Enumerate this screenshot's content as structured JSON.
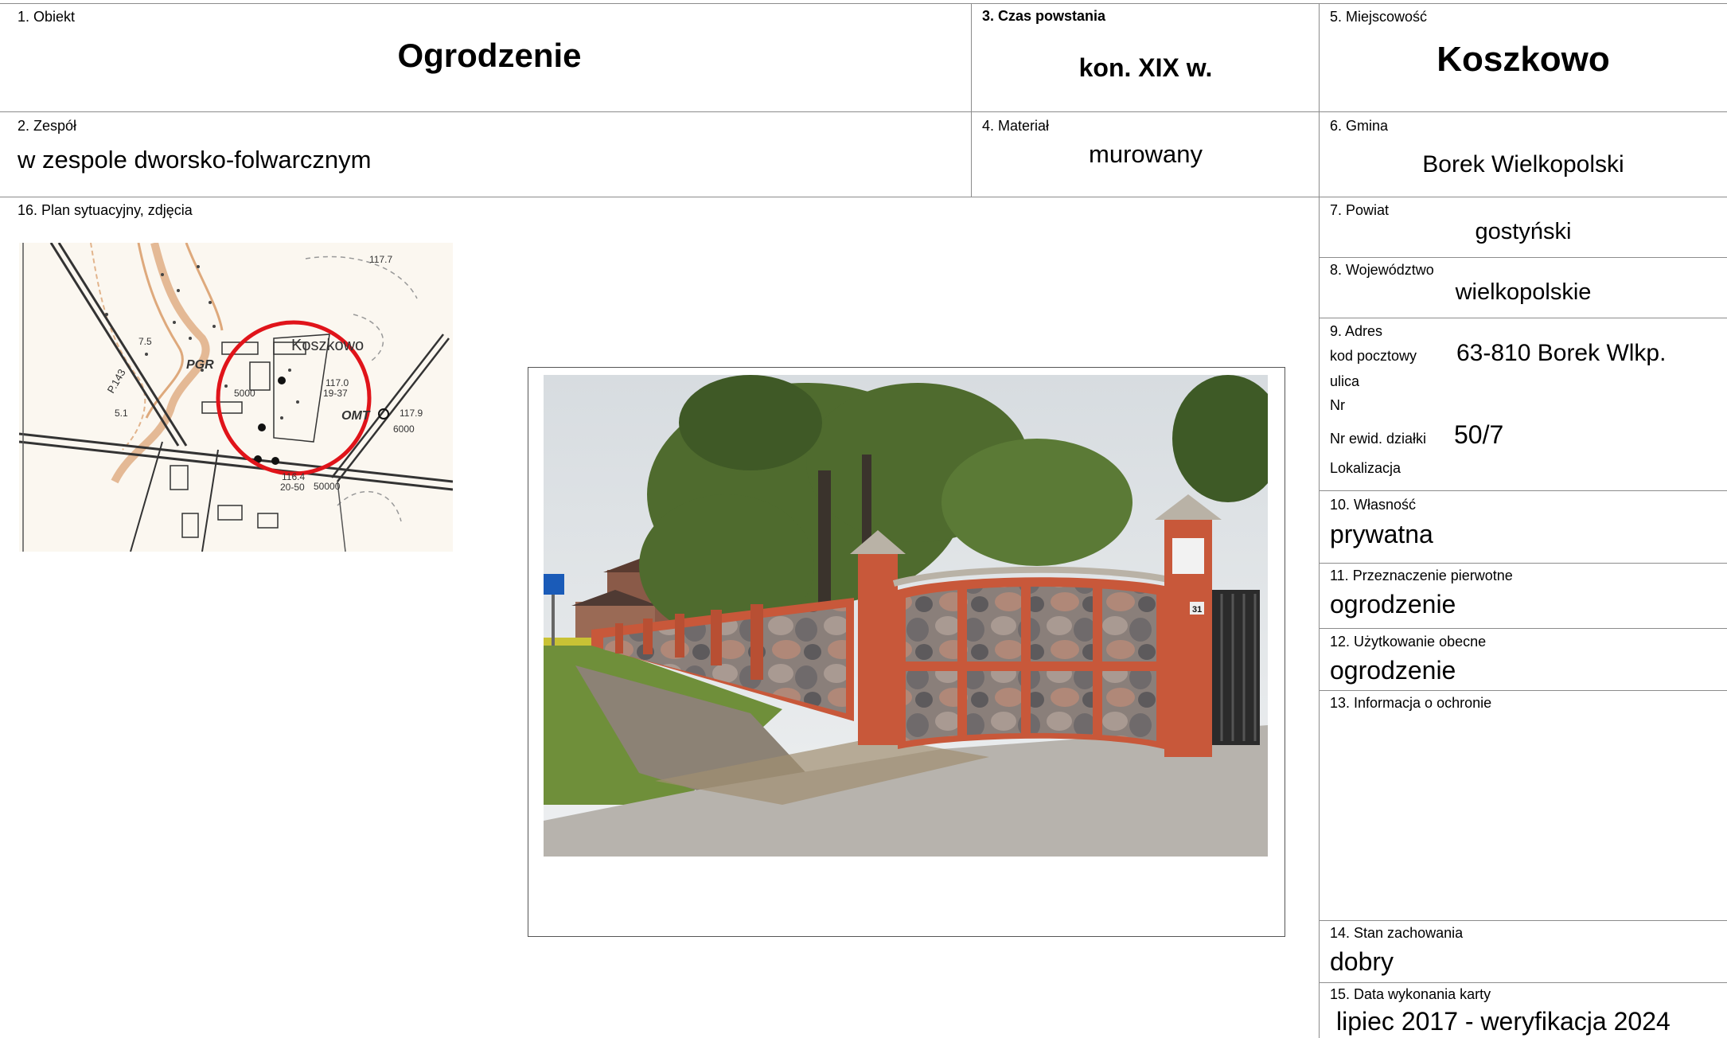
{
  "card": {
    "obiekt": {
      "label": "1. Obiekt",
      "value": "Ogrodzenie"
    },
    "zespol": {
      "label": "2. Zespół",
      "value": "w zespole dworsko-folwarcznym"
    },
    "czas": {
      "label": "3. Czas powstania",
      "value": "kon. XIX w."
    },
    "material": {
      "label": "4. Materiał",
      "value": "murowany"
    },
    "miejscowosc": {
      "label": "5. Miejscowość",
      "value": "Koszkowo"
    },
    "gmina": {
      "label": "6. Gmina",
      "value": "Borek Wielkopolski"
    },
    "powiat": {
      "label": "7. Powiat",
      "value": "gostyński"
    },
    "wojewodztwo": {
      "label": "8. Województwo",
      "value": "wielkopolskie"
    },
    "adres": {
      "label": "9. Adres",
      "kod_label": "kod pocztowy",
      "kod_value": "63-810 Borek Wlkp.",
      "ulica_label": "ulica",
      "nr_label": "Nr",
      "dzialka_label": "Nr ewid. działki",
      "dzialka_value": "50/7",
      "lokalizacja_label": "Lokalizacja"
    },
    "wlasnosc": {
      "label": "10. Własność",
      "value": "prywatna"
    },
    "przeznaczenie": {
      "label": "11. Przeznaczenie pierwotne",
      "value": "ogrodzenie"
    },
    "uzytkowanie": {
      "label": "12. Użytkowanie obecne",
      "value": "ogrodzenie"
    },
    "ochrona": {
      "label": "13. Informacja o ochronie",
      "value": ""
    },
    "stan": {
      "label": "14. Stan zachowania",
      "value": "dobry"
    },
    "data": {
      "label": "15. Data wykonania karty",
      "value": "lipiec 2017 - weryfikacja 2024"
    },
    "plan": {
      "label": "16. Plan sytuacyjny, zdjęcia"
    }
  },
  "map": {
    "place_label": "Koszkowo",
    "labels": [
      "PGR",
      "OMT",
      "5000",
      "6000",
      "50000",
      "117.7",
      "117.9",
      "117.0",
      "19-37",
      "116.4",
      "20-50",
      "P.143",
      "7.5",
      "5.1"
    ],
    "colors": {
      "circle": "#e0141a",
      "contour": "#d2874a",
      "road": "#333333"
    }
  },
  "photo": {
    "gate_number": "31",
    "colors": {
      "sky": "#dfe3e6",
      "brick": "#c8583a",
      "stone": "#8a7f7a",
      "foliage": "#4f6b2e",
      "pavement": "#b7b3ad",
      "grass": "#6f8f3a"
    }
  }
}
